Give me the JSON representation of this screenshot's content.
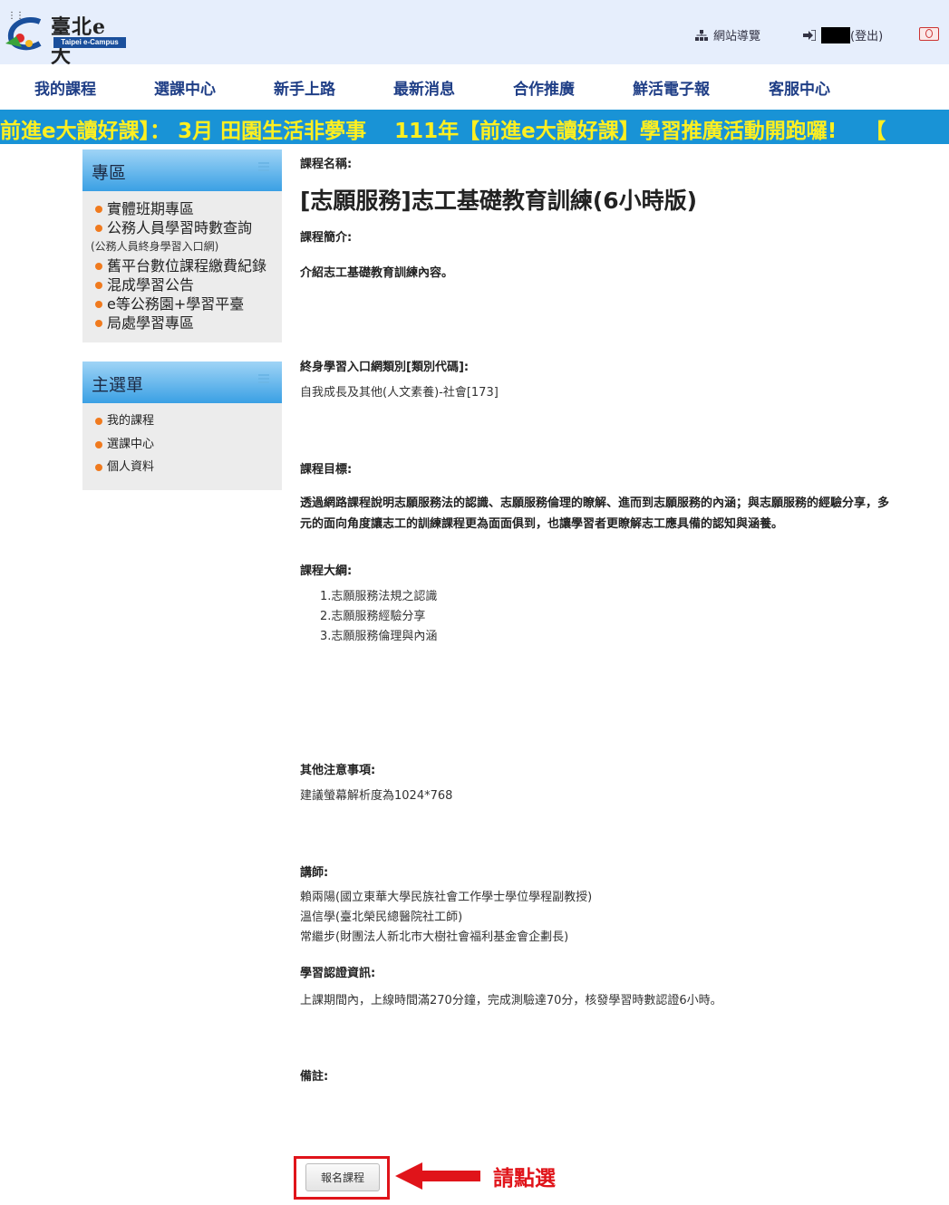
{
  "header": {
    "logo_brand": "臺北e大",
    "logo_sub": "Taipei e-Campus",
    "sitemap_label": "網站導覽",
    "logout_label": "(登出)"
  },
  "nav": {
    "items": [
      "我的課程",
      "選課中心",
      "新手上路",
      "最新消息",
      "合作推廣",
      "鮮活電子報",
      "客服中心"
    ]
  },
  "marquee": {
    "text": "前進e大讀好課】： 3月 田園生活非夢事　 111年【前進e大讀好課】學習推廣活動開跑囉!　 【"
  },
  "sidebar": {
    "zone": {
      "title": "專區",
      "items": [
        "實體班期專區",
        "公務人員學習時數查詢",
        "舊平台數位課程繳費紀錄",
        "混成學習公告",
        "e等公務園+學習平臺",
        "局處學習專區"
      ],
      "note": "(公務人員終身學習入口網)"
    },
    "main_menu": {
      "title": "主選單",
      "items": [
        "我的課程",
        "選課中心",
        "個人資料"
      ]
    }
  },
  "course": {
    "name_label": "課程名稱:",
    "name": "[志願服務]志工基礎教育訓練(6小時版)",
    "intro_label": "課程簡介:",
    "intro": "介紹志工基礎教育訓練內容。",
    "category_label": "終身學習入口網類別[類別代碼]:",
    "category": "自我成長及其他(人文素養)-社會[173]",
    "goal_label": "課程目標:",
    "goal_line1": "透過網路課程說明志願服務法的認識、志願服務倫理的瞭解、進而到志願服務的內涵；與志願服務的經驗分享，多",
    "goal_line2": "元的面向角度讓志工的訓練課程更為面面俱到，也讓學習者更瞭解志工應具備的認知與涵養。",
    "outline_label": "課程大綱:",
    "outline": [
      "1.志願服務法規之認識",
      "2.志願服務經驗分享",
      "3.志願服務倫理與內涵"
    ],
    "notes_label": "其他注意事項:",
    "notes": "建議螢幕解析度為1024*768",
    "teacher_label": "講師:",
    "teachers": [
      "賴兩陽(國立東華大學民族社會工作學士學位學程副教授)",
      "溫信學(臺北榮民總醫院社工師)",
      "常繼步(財團法人新北市大樹社會福利基金會企劃長)"
    ],
    "cert_label": "學習認證資訊:",
    "cert": "上課期間內，上線時間滿270分鐘，完成測驗達70分，核發學習時數認證6小時。",
    "remark_label": "備註:",
    "enroll_button": "報名課程",
    "callout": "請點選"
  },
  "colors": {
    "nav_text": "#1f3e86",
    "marquee_bg": "#1993d6",
    "marquee_text": "#ffef20",
    "bullet": "#f07a1e",
    "highlight": "#e0141a"
  }
}
